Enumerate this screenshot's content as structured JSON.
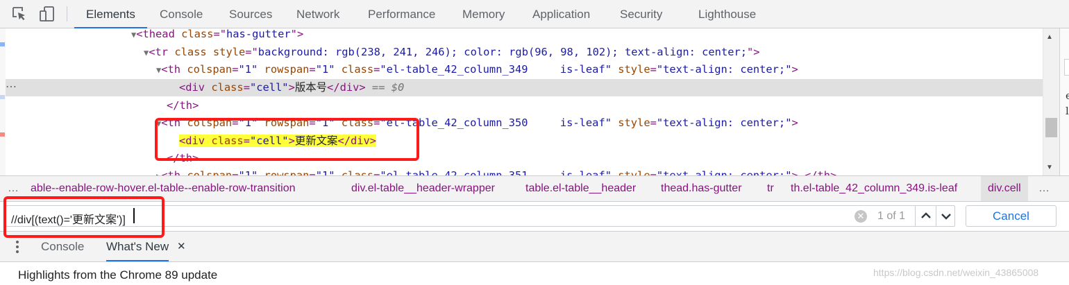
{
  "toolbar": {
    "icons": [
      "inspect-element-icon",
      "device-toolbar-icon"
    ],
    "tabs": [
      "Elements",
      "Console",
      "Sources",
      "Network",
      "Performance",
      "Memory",
      "Application",
      "Security",
      "Lighthouse"
    ],
    "active_tab": "Elements"
  },
  "dom_tree": {
    "lines": [
      {
        "arrow": "▼",
        "t1": "<thead ",
        "a1": "class",
        "eq1": "=\"",
        "v1": "has-gutter",
        "close1": "\">"
      },
      {
        "arrow": "▼",
        "t1": "<tr ",
        "a1": "class style",
        "eq1": "=\"",
        "v1": "background: rgb(238, 241, 246); color: rgb(96, 98, 102); text-align: center;",
        "close1": "\">"
      },
      {
        "arrow": "▼",
        "t1": "<th ",
        "a1": "colspan",
        "v1": "\"1\"",
        "a2": " rowspan",
        "v2": "\"1\"",
        "a3": " class",
        "v3": "\"el-table_42_column_349     is-leaf\"",
        "a4": " style",
        "v4": "\"text-align: center;\"",
        "close": ">"
      },
      {
        "open": "<div ",
        "a": "class",
        "v": "\"cell\"",
        "gt": ">",
        "text": "版本号",
        "close": "</div>",
        "eq0": " == $0"
      },
      {
        "close": "</th>"
      },
      {
        "arrow": "▼",
        "t1": "<th ",
        "a1": "colspan",
        "v1": "\"1\"",
        "a2": " rowspan",
        "v2": "\"1\"",
        "a3": " class",
        "v3": "\"el-table_42_column_350     is-leaf\"",
        "a4": " style",
        "v4": "\"text-align: center;\"",
        "close": ">"
      },
      {
        "open": "<div ",
        "a": "class",
        "v": "\"cell\"",
        "gt": ">",
        "text": "更新文案",
        "close": "</div>"
      },
      {
        "close": "</th>"
      },
      {
        "arrow": "▶",
        "t1": "<th ",
        "a1": "colspan",
        "v1": "\"1\"",
        "a2": " rowspan",
        "v2": "\"1\"",
        "a3": " class",
        "v3": "\"el-table_42_column_351     is-leaf\"",
        "a4": " style",
        "v4": "\"text-align: center;\"",
        "close": ">…</th>"
      }
    ],
    "gutter_dots": "⋯"
  },
  "breadcrumb": {
    "items": [
      "able--enable-row-hover.el-table--enable-row-transition",
      "div.el-table__header-wrapper",
      "table.el-table__header",
      "thead.has-gutter",
      "tr",
      "th.el-table_42_column_349.is-leaf",
      "div.cell"
    ],
    "more": "…"
  },
  "search": {
    "query": "//div[(text()='更新文案')]",
    "match_count": "1 of 1",
    "cancel_label": "Cancel"
  },
  "drawer": {
    "tabs": [
      "Console",
      "What's New"
    ],
    "active_tab": "What's New",
    "close_glyph": "✕",
    "highlights": "Highlights from the Chrome 89 update",
    "watermark": "https://blog.csdn.net/weixin_43865008"
  },
  "right_panel": {
    "letters": [
      "e",
      "l"
    ]
  },
  "colors": {
    "accent": "#1a73e8",
    "tag": "#881280",
    "attr_name": "#994500",
    "attr_value": "#1a1aa6",
    "highlight": "#ffff3a",
    "annotation": "#ff1a1a"
  }
}
